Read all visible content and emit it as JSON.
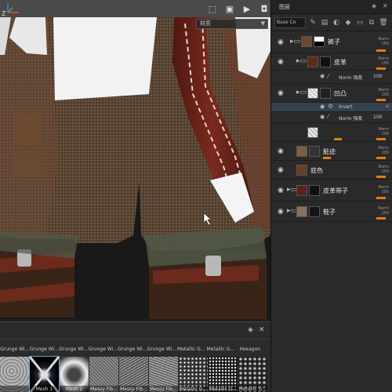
{
  "viewport": {
    "toolbar_icons": [
      "frame-icon",
      "cube-icon",
      "video-icon",
      "camera-icon"
    ],
    "dropdown_label": "材质",
    "axis_label": "Z"
  },
  "shelf": {
    "material_names": [
      "Grunge Wi...",
      "Grunge Wi...",
      "Grunge Wi...",
      "Grunge Wi...",
      "Grunge Wi...",
      "Grunge Wi...",
      "Metallic G...",
      "Metallic G...",
      "Hexagon"
    ],
    "thumbnails": [
      {
        "label": "",
        "pattern": "noise-light"
      },
      {
        "label": "Mesh 1",
        "pattern": "mesh-cross"
      },
      {
        "label": "Mesh 2",
        "pattern": "mesh-soft"
      },
      {
        "label": "Messy Fib...",
        "pattern": "noise-fibers"
      },
      {
        "label": "Messy Fib...",
        "pattern": "noise-fibers"
      },
      {
        "label": "Messy Fib...",
        "pattern": "noise-fibers"
      },
      {
        "label": "Metallic G...",
        "pattern": "dots-diag"
      },
      {
        "label": "Metallic G...",
        "pattern": "dots-dark"
      },
      {
        "label": "Metallic G...",
        "pattern": "hex"
      }
    ]
  },
  "layers": {
    "title": "图层",
    "blend_select": "Base Co",
    "rows": [
      {
        "name": "裤子",
        "type": "folder",
        "mode": "Norm",
        "opacity": "100"
      },
      {
        "name": "皮革",
        "type": "folder",
        "mode": "Norm",
        "opacity": "100"
      },
      {
        "name": "Norm 强度",
        "type": "sub",
        "opacity": "100"
      },
      {
        "name": "凹凸",
        "type": "folder",
        "mode": "Norm",
        "opacity": "100"
      },
      {
        "name": "Invert",
        "type": "effect"
      },
      {
        "name": "Norm 强度",
        "type": "sub",
        "opacity": "100"
      },
      {
        "name": "",
        "type": "layer",
        "mode": "Norm",
        "opacity": "100"
      },
      {
        "name": "脏迹",
        "type": "layer",
        "mode": "Norm",
        "opacity": "100"
      },
      {
        "name": "底色",
        "type": "layer",
        "mode": "Norm",
        "opacity": "100"
      },
      {
        "name": "皮革带子",
        "type": "layer",
        "mode": "Norm",
        "opacity": "100"
      },
      {
        "name": "鞋子",
        "type": "layer",
        "mode": "Norm",
        "opacity": "100"
      }
    ]
  }
}
